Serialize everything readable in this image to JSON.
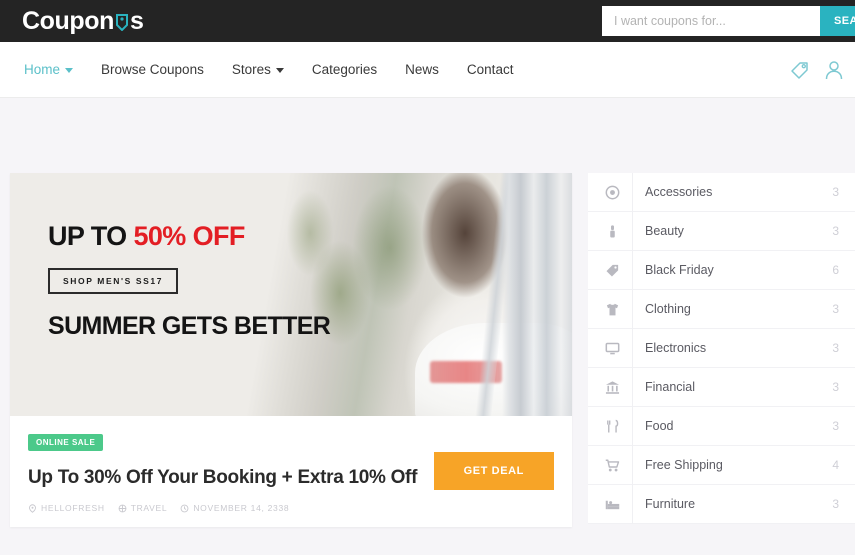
{
  "header": {
    "logo_text_before": "Coupon",
    "logo_icon": "price-tag-icon",
    "logo_text_after": "s",
    "search": {
      "placeholder": "I want coupons for...",
      "value": "",
      "button_label": "SEARCH"
    },
    "bar_color": "#242424",
    "accent_color": "#2ab3c0"
  },
  "nav": {
    "items": [
      {
        "label": "Home",
        "has_caret": true,
        "active": true
      },
      {
        "label": "Browse Coupons",
        "has_caret": false,
        "active": false
      },
      {
        "label": "Stores",
        "has_caret": true,
        "active": false
      },
      {
        "label": "Categories",
        "has_caret": false,
        "active": false
      },
      {
        "label": "News",
        "has_caret": false,
        "active": false
      },
      {
        "label": "Contact",
        "has_caret": false,
        "active": false
      }
    ],
    "icons": [
      {
        "name": "tag-icon"
      },
      {
        "name": "user-account-icon"
      }
    ],
    "active_color": "#5bc0c9"
  },
  "hero": {
    "line1_prefix": "UP TO ",
    "line1_highlight": "50% OFF",
    "highlight_color": "#e31e24",
    "button_box_label": "SHOP MEN'S SS17",
    "line2": "SUMMER GETS BETTER"
  },
  "coupon": {
    "badge": "ONLINE SALE",
    "badge_color": "#4cc98a",
    "title": "Up To 30% Off Your Booking + Extra 10% Off",
    "meta": [
      {
        "icon": "location-pin-icon",
        "text": "HELLOFRESH"
      },
      {
        "icon": "globe-icon",
        "text": "TRAVEL"
      },
      {
        "icon": "clock-icon",
        "text": "NOVEMBER 14, 2338"
      }
    ],
    "action_label": "GET DEAL",
    "action_color": "#f7a427"
  },
  "sidebar": {
    "categories": [
      {
        "icon": "target-circle-icon",
        "label": "Accessories",
        "count": "3"
      },
      {
        "icon": "lipstick-icon",
        "label": "Beauty",
        "count": "3"
      },
      {
        "icon": "tag-icon",
        "label": "Black Friday",
        "count": "6"
      },
      {
        "icon": "shirt-icon",
        "label": "Clothing",
        "count": "3"
      },
      {
        "icon": "monitor-icon",
        "label": "Electronics",
        "count": "3"
      },
      {
        "icon": "bank-icon",
        "label": "Financial",
        "count": "3"
      },
      {
        "icon": "cutlery-icon",
        "label": "Food",
        "count": "3"
      },
      {
        "icon": "shopping-cart-icon",
        "label": "Free Shipping",
        "count": "4"
      },
      {
        "icon": "bed-icon",
        "label": "Furniture",
        "count": "3"
      }
    ]
  }
}
